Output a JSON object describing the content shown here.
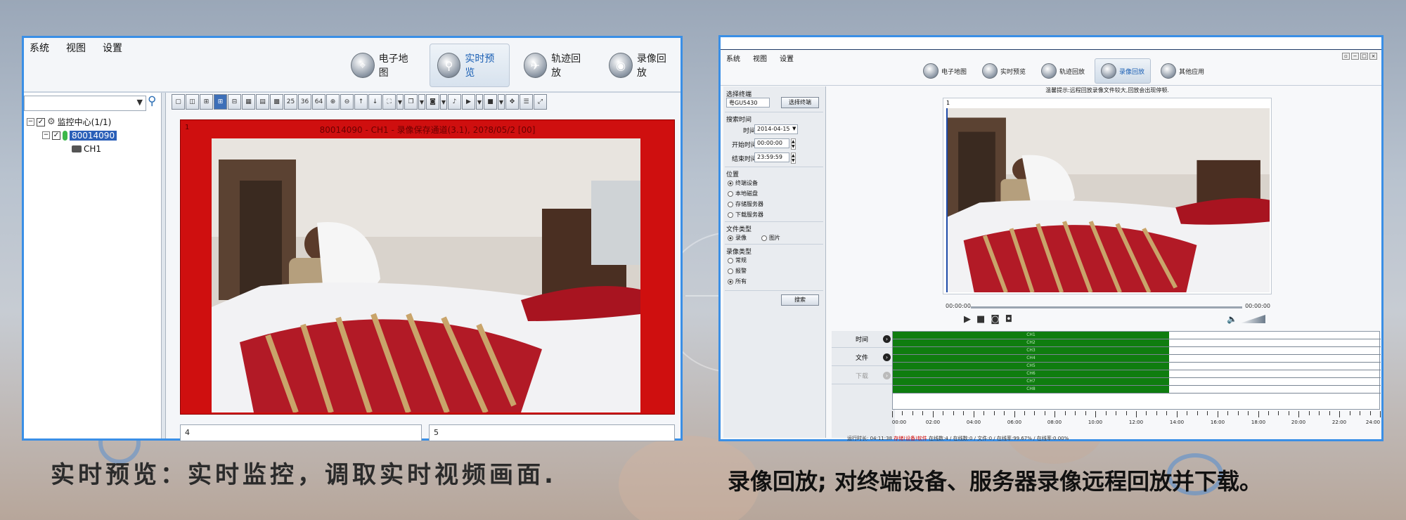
{
  "left_window": {
    "menu": [
      "系统",
      "视图",
      "设置"
    ],
    "tabs": [
      {
        "label": "电子地图",
        "icon": "map-icon",
        "active": false
      },
      {
        "label": "实时预览",
        "icon": "search-icon",
        "active": true
      },
      {
        "label": "轨迹回放",
        "icon": "track-icon",
        "active": false
      },
      {
        "label": "录像回放",
        "icon": "record-icon",
        "active": false
      }
    ],
    "tree": {
      "root": "监控中心(1/1)",
      "device": "80014090",
      "channel": "CH1"
    },
    "video_caption": "80014090 - CH1 - 录像保存通道(3.1), 20?8/05/2 [00]",
    "video_index": "1",
    "cells": [
      "4",
      "5"
    ]
  },
  "caption_left": "实时预览：实时监控，调取实时视频画面.",
  "right_window": {
    "menu": [
      "系统",
      "视图",
      "设置"
    ],
    "tabs": [
      {
        "label": "电子地图",
        "active": false
      },
      {
        "label": "实时预览",
        "active": false
      },
      {
        "label": "轨迹回放",
        "active": false
      },
      {
        "label": "录像回放",
        "active": true
      },
      {
        "label": "其他应用",
        "active": false
      }
    ],
    "panel": {
      "select_terminal_label": "选择终端",
      "terminal_value": "粤GU5430",
      "select_terminal_button": "选择终端",
      "search_time_label": "搜索时间",
      "time_label": "时间",
      "date_value": "2014-04-15",
      "start_label": "开始时间",
      "start_value": "00:00:00",
      "end_label": "结束时间",
      "end_value": "23:59:59",
      "location_label": "位置",
      "locations": [
        "终端设备",
        "本地磁盘",
        "存储服务器",
        "下载服务器"
      ],
      "file_type_label": "文件类型",
      "file_types": [
        "录像",
        "图片"
      ],
      "record_type_label": "录像类型",
      "record_types": [
        "常规",
        "报警",
        "所有"
      ],
      "search_button": "搜索"
    },
    "notice": "温馨提示:远程回放录像文件较大,回放会出现停顿.",
    "video_index": "1",
    "time_start": "00:00:00",
    "time_end": "00:00:00",
    "timeline_rows": [
      "时间",
      "文件",
      "下载"
    ],
    "channels": [
      "CH1",
      "CH2",
      "CH3",
      "CH4",
      "CH5",
      "CH6",
      "CH7",
      "CH8"
    ],
    "channel_fill_until_hour": 13.6,
    "axis_labels": [
      "00:00",
      "02:00",
      "04:00",
      "06:00",
      "08:00",
      "10:00",
      "12:00",
      "14:00",
      "16:00",
      "18:00",
      "20:00",
      "22:00",
      "24:00"
    ],
    "status_prefix": "运行时长: 04:11:38",
    "status_red": "存储(设备)软件",
    "status_rest": "在线数:4 / 在线数:0 / 文件:0 / 在线率:99.67% / 在线率:0.00%"
  },
  "caption_right": "录像回放; 对终端设备、服务器录像远程回放并下载。",
  "colors": {
    "window_border": "#3a8fe6",
    "video_red": "#cf0f0f",
    "timeline_green": "#0f7d0f",
    "selected_blue": "#2a5fb8"
  }
}
